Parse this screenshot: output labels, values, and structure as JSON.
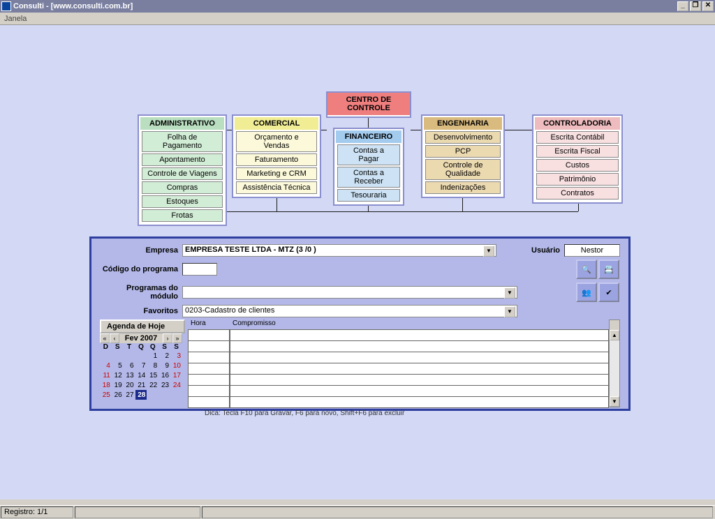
{
  "window": {
    "title": "Consulti - [www.consulti.com.br]",
    "menu": "Janela"
  },
  "center": {
    "title": "CENTRO DE CONTROLE"
  },
  "modules": {
    "admin": {
      "title": "ADMINISTRATIVO",
      "items": [
        "Folha de Pagamento",
        "Apontamento",
        "Controle de Viagens",
        "Compras",
        "Estoques",
        "Frotas"
      ]
    },
    "com": {
      "title": "COMERCIAL",
      "items": [
        "Orçamento e Vendas",
        "Faturamento",
        "Marketing e CRM",
        "Assistência Técnica"
      ]
    },
    "fin": {
      "title": "FINANCEIRO",
      "items": [
        "Contas a Pagar",
        "Contas a Receber",
        "Tesouraria"
      ]
    },
    "eng": {
      "title": "ENGENHARIA",
      "items": [
        "Desenvolvimento",
        "PCP",
        "Controle de Qualidade",
        "Indenizações"
      ]
    },
    "ctrl": {
      "title": "CONTROLADORIA",
      "items": [
        "Escrita Contábil",
        "Escrita Fiscal",
        "Custos",
        "Patrimônio",
        "Contratos"
      ]
    }
  },
  "form": {
    "empresa_label": "Empresa",
    "empresa_value": "EMPRESA TESTE LTDA - MTZ (3 /0 )",
    "usuario_label": "Usuário",
    "usuario_value": "Nestor",
    "codigo_label": "Código do programa",
    "codigo_value": "",
    "programas_label": "Programas do módulo",
    "programas_value": "",
    "favoritos_label": "Favoritos",
    "favoritos_value": "0203-Cadastro de clientes",
    "agenda_button": "Agenda de Hoje",
    "hora_label": "Hora",
    "compromisso_label": "Compromisso",
    "hint": "Dica: Tecla F10 para Gravar, F6 para novo, Shift+F6 para excluir"
  },
  "calendar": {
    "title": "Fev 2007",
    "dow": [
      "D",
      "S",
      "T",
      "Q",
      "Q",
      "S",
      "S"
    ],
    "weeks": [
      [
        "",
        "",
        "",
        "",
        "1",
        "2",
        "3"
      ],
      [
        "4",
        "5",
        "6",
        "7",
        "8",
        "9",
        "10"
      ],
      [
        "11",
        "12",
        "13",
        "14",
        "15",
        "16",
        "17"
      ],
      [
        "18",
        "19",
        "20",
        "21",
        "22",
        "23",
        "24"
      ],
      [
        "25",
        "26",
        "27",
        "28",
        "",
        "",
        ""
      ]
    ],
    "today": "28"
  },
  "status": {
    "record": "Registro: 1/1"
  }
}
